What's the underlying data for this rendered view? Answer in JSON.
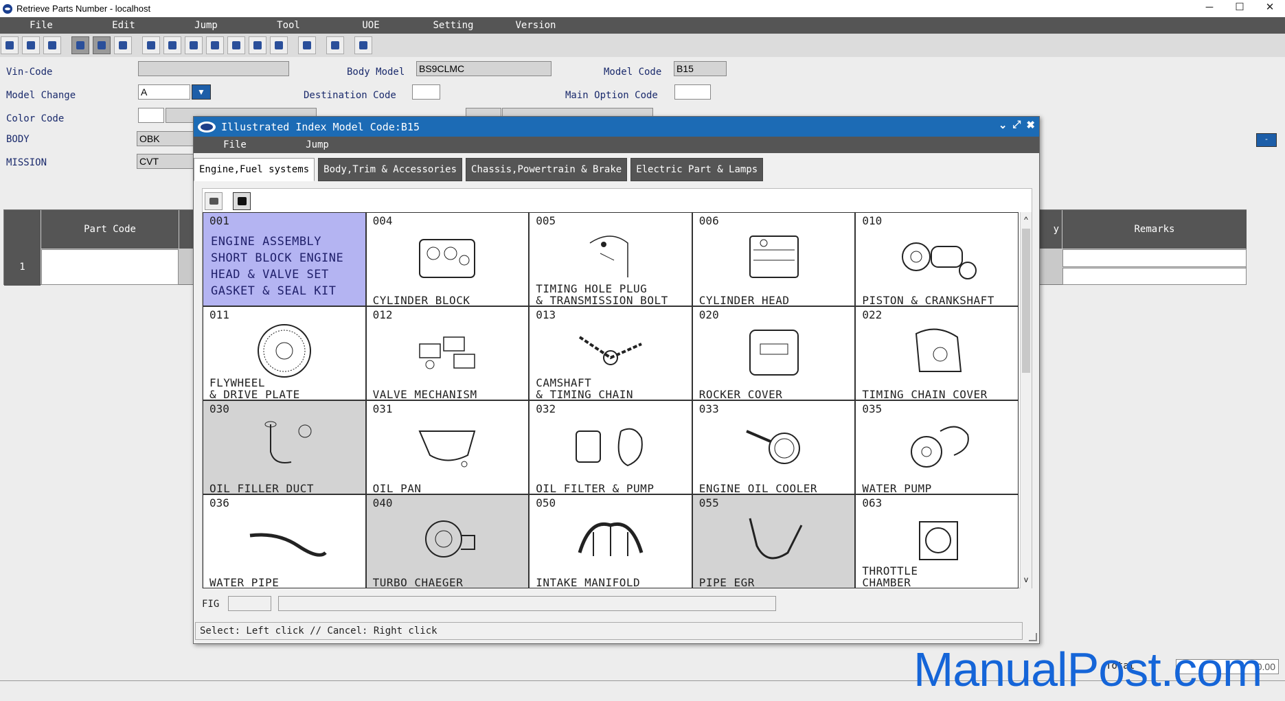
{
  "window": {
    "title": "Retrieve Parts Number - localhost",
    "min": "─",
    "max": "☐",
    "close": "✕"
  },
  "menu": [
    "File",
    "Edit",
    "Jump",
    "Tool",
    "UOE",
    "Setting",
    "Version"
  ],
  "form": {
    "vin_label": "Vin-Code",
    "vin_value": "",
    "body_model_label": "Body Model",
    "body_model_value": "BS9CLMC",
    "model_code_label": "Model Code",
    "model_code_value": "B15",
    "model_change_label": "Model Change",
    "model_change_value": "A",
    "destination_label": "Destination Code",
    "destination_value": "",
    "main_option_label": "Main Option Code",
    "main_option_value": "",
    "color_label": "Color Code",
    "color_value": "",
    "body_label": "BODY",
    "body_value": "OBK",
    "mission_label": "MISSION",
    "mission_value": "CVT",
    "dropdown_icon": "▼"
  },
  "table": {
    "part_code_header": "Part Code",
    "qty_header": "y",
    "remarks_header": "Remarks",
    "row_num": "1"
  },
  "side_button": "-",
  "total": {
    "label": "Total",
    "value": "0.00"
  },
  "watermark": "ManualPost.com",
  "dialog": {
    "title": "Illustrated Index Model Code:B15",
    "ctrl_collapse": "⌄",
    "ctrl_expand": "⤢",
    "ctrl_close": "✖",
    "menu": [
      "File",
      "Jump"
    ],
    "tabs": [
      "Engine,Fuel systems",
      "Body,Trim & Accessories",
      "Chassis,Powertrain & Brake",
      "Electric Part & Lamps"
    ],
    "fig_label": "FIG",
    "status": "Select: Left click // Cancel: Right click",
    "scroll_up": "^",
    "scroll_down": "v",
    "selected": {
      "code": "001",
      "lines": [
        "ENGINE ASSEMBLY",
        "SHORT BLOCK ENGINE",
        "HEAD & VALVE SET",
        "GASKET & SEAL KIT"
      ]
    },
    "cells": [
      {
        "code": "004",
        "label": "CYLINDER BLOCK",
        "icon": "cylinder-block"
      },
      {
        "code": "005",
        "label": "TIMING HOLE PLUG\n& TRANSMISSION BOLT",
        "icon": "timing-plug"
      },
      {
        "code": "006",
        "label": "CYLINDER HEAD",
        "icon": "cylinder-head"
      },
      {
        "code": "010",
        "label": "PISTON & CRANKSHAFT",
        "icon": "crankshaft"
      },
      {
        "code": "011",
        "label": "FLYWHEEL\n& DRIVE PLATE",
        "icon": "flywheel"
      },
      {
        "code": "012",
        "label": "VALVE MECHANISM",
        "icon": "valve"
      },
      {
        "code": "013",
        "label": "CAMSHAFT\n& TIMING CHAIN",
        "icon": "camshaft"
      },
      {
        "code": "020",
        "label": "ROCKER COVER",
        "icon": "rocker-cover"
      },
      {
        "code": "022",
        "label": "TIMING CHAIN COVER",
        "icon": "chain-cover"
      },
      {
        "code": "030",
        "label": "OIL FILLER DUCT",
        "icon": "filler-duct",
        "gray": true
      },
      {
        "code": "031",
        "label": "OIL PAN",
        "icon": "oil-pan"
      },
      {
        "code": "032",
        "label": "OIL FILTER & PUMP",
        "icon": "oil-filter"
      },
      {
        "code": "033",
        "label": "ENGINE OIL COOLER",
        "icon": "oil-cooler"
      },
      {
        "code": "035",
        "label": "WATER PUMP",
        "icon": "water-pump"
      },
      {
        "code": "036",
        "label": "WATER PIPE",
        "icon": "water-pipe"
      },
      {
        "code": "040",
        "label": "TURBO CHAEGER",
        "icon": "turbo",
        "gray": true
      },
      {
        "code": "050",
        "label": "INTAKE MANIFOLD",
        "icon": "intake"
      },
      {
        "code": "055",
        "label": "PIPE EGR",
        "icon": "egr",
        "gray": true
      },
      {
        "code": "063",
        "label": "THROTTLE\nCHAMBER",
        "icon": "throttle"
      }
    ]
  }
}
